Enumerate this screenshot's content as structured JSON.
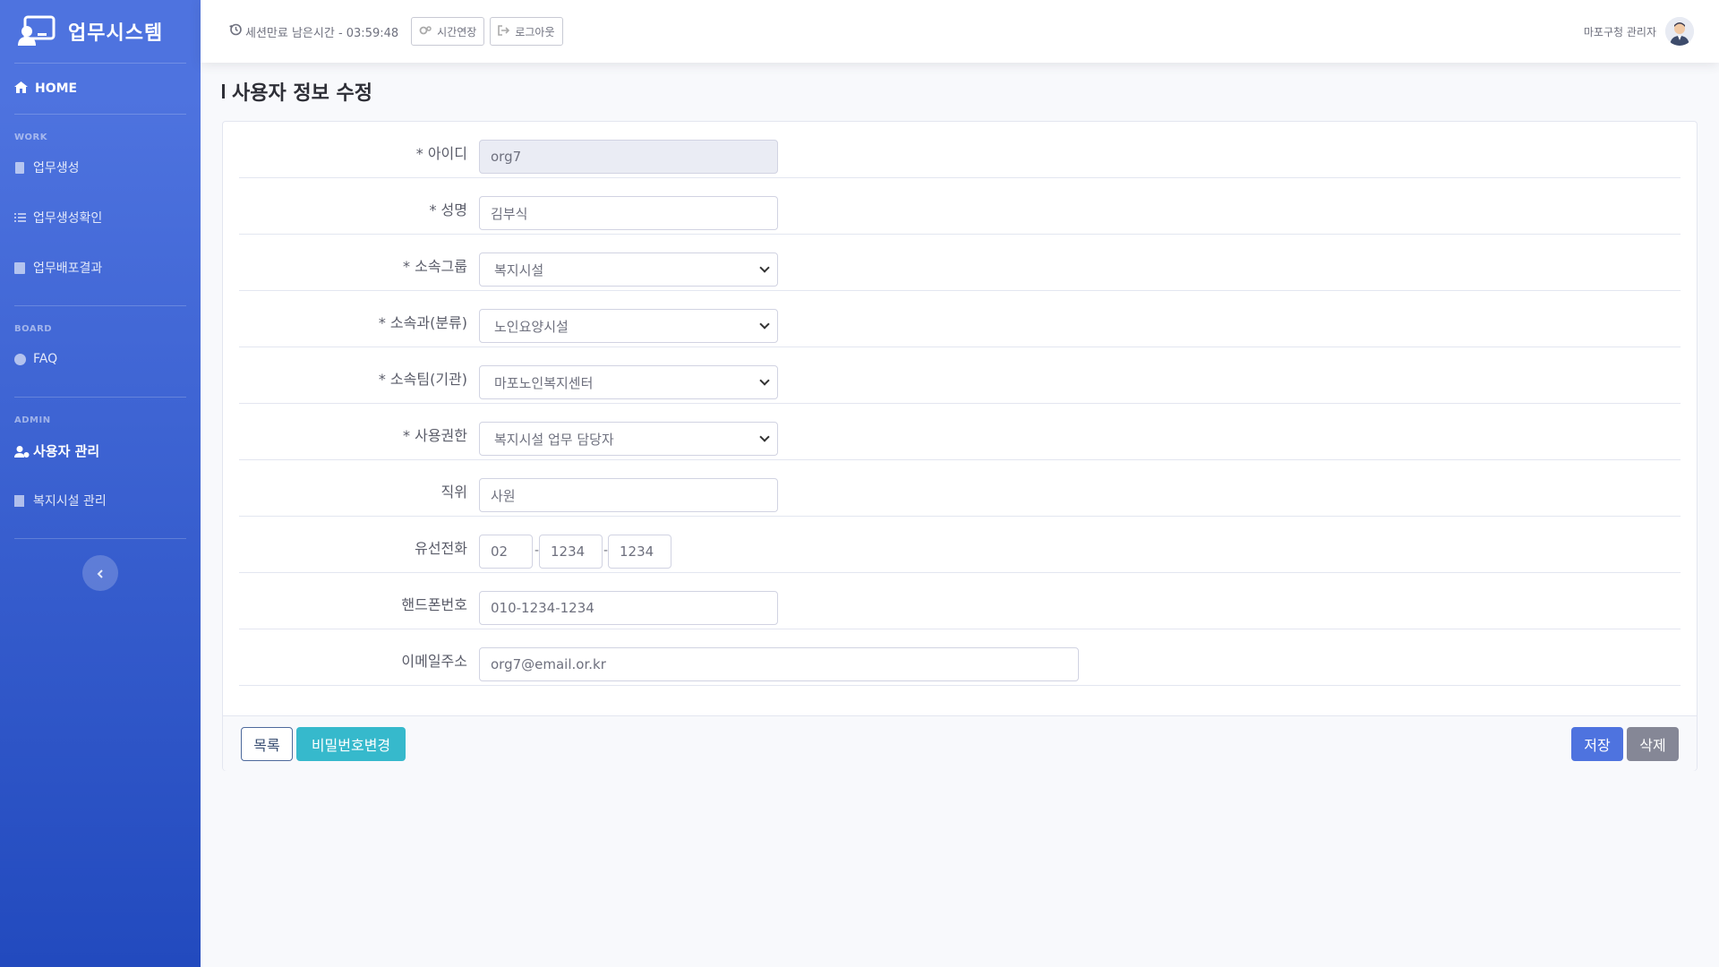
{
  "sidebar": {
    "brand": "업무시스템",
    "home": "HOME",
    "sections": [
      {
        "title": "WORK",
        "items": [
          {
            "label": "업무생성"
          },
          {
            "label": "업무생성확인"
          },
          {
            "label": "업무배포결과"
          }
        ]
      },
      {
        "title": "BOARD",
        "items": [
          {
            "label": "FAQ"
          }
        ]
      },
      {
        "title": "ADMIN",
        "items": [
          {
            "label": "사용자 관리",
            "active": true
          },
          {
            "label": "복지시설 관리"
          }
        ]
      }
    ],
    "toggle_icon": "chevron-left-icon"
  },
  "topbar": {
    "session_text": "세션만료 남은시간 - 03:59:48",
    "extend_label": "시간연장",
    "logout_label": "로그아웃",
    "user_name": "마포구청 관리자"
  },
  "page": {
    "title": "사용자 정보 수정"
  },
  "form": {
    "id": {
      "label": "* 아이디",
      "value": "org7"
    },
    "name": {
      "label": "* 성명",
      "value": "김부식"
    },
    "group": {
      "label": "* 소속그룹",
      "value": "복지시설"
    },
    "dept": {
      "label": "* 소속과(분류)",
      "value": "노인요양시설"
    },
    "team": {
      "label": "* 소속팀(기관)",
      "value": "마포노인복지센터"
    },
    "role": {
      "label": "* 사용권한",
      "value": "복지시설 업무 담당자"
    },
    "position": {
      "label": "직위",
      "value": "사원"
    },
    "phone": {
      "label": "유선전화",
      "part1": "02",
      "part2": "1234",
      "part3": "1234"
    },
    "mobile": {
      "label": "핸드폰번호",
      "value": "010-1234-1234"
    },
    "email": {
      "label": "이메일주소",
      "value": "org7@email.or.kr"
    }
  },
  "buttons": {
    "list": "목록",
    "change_password": "비밀번호변경",
    "save": "저장",
    "delete": "삭제"
  },
  "colors": {
    "primary": "#4e73df",
    "info": "#36b9cc",
    "secondary": "#858796"
  }
}
